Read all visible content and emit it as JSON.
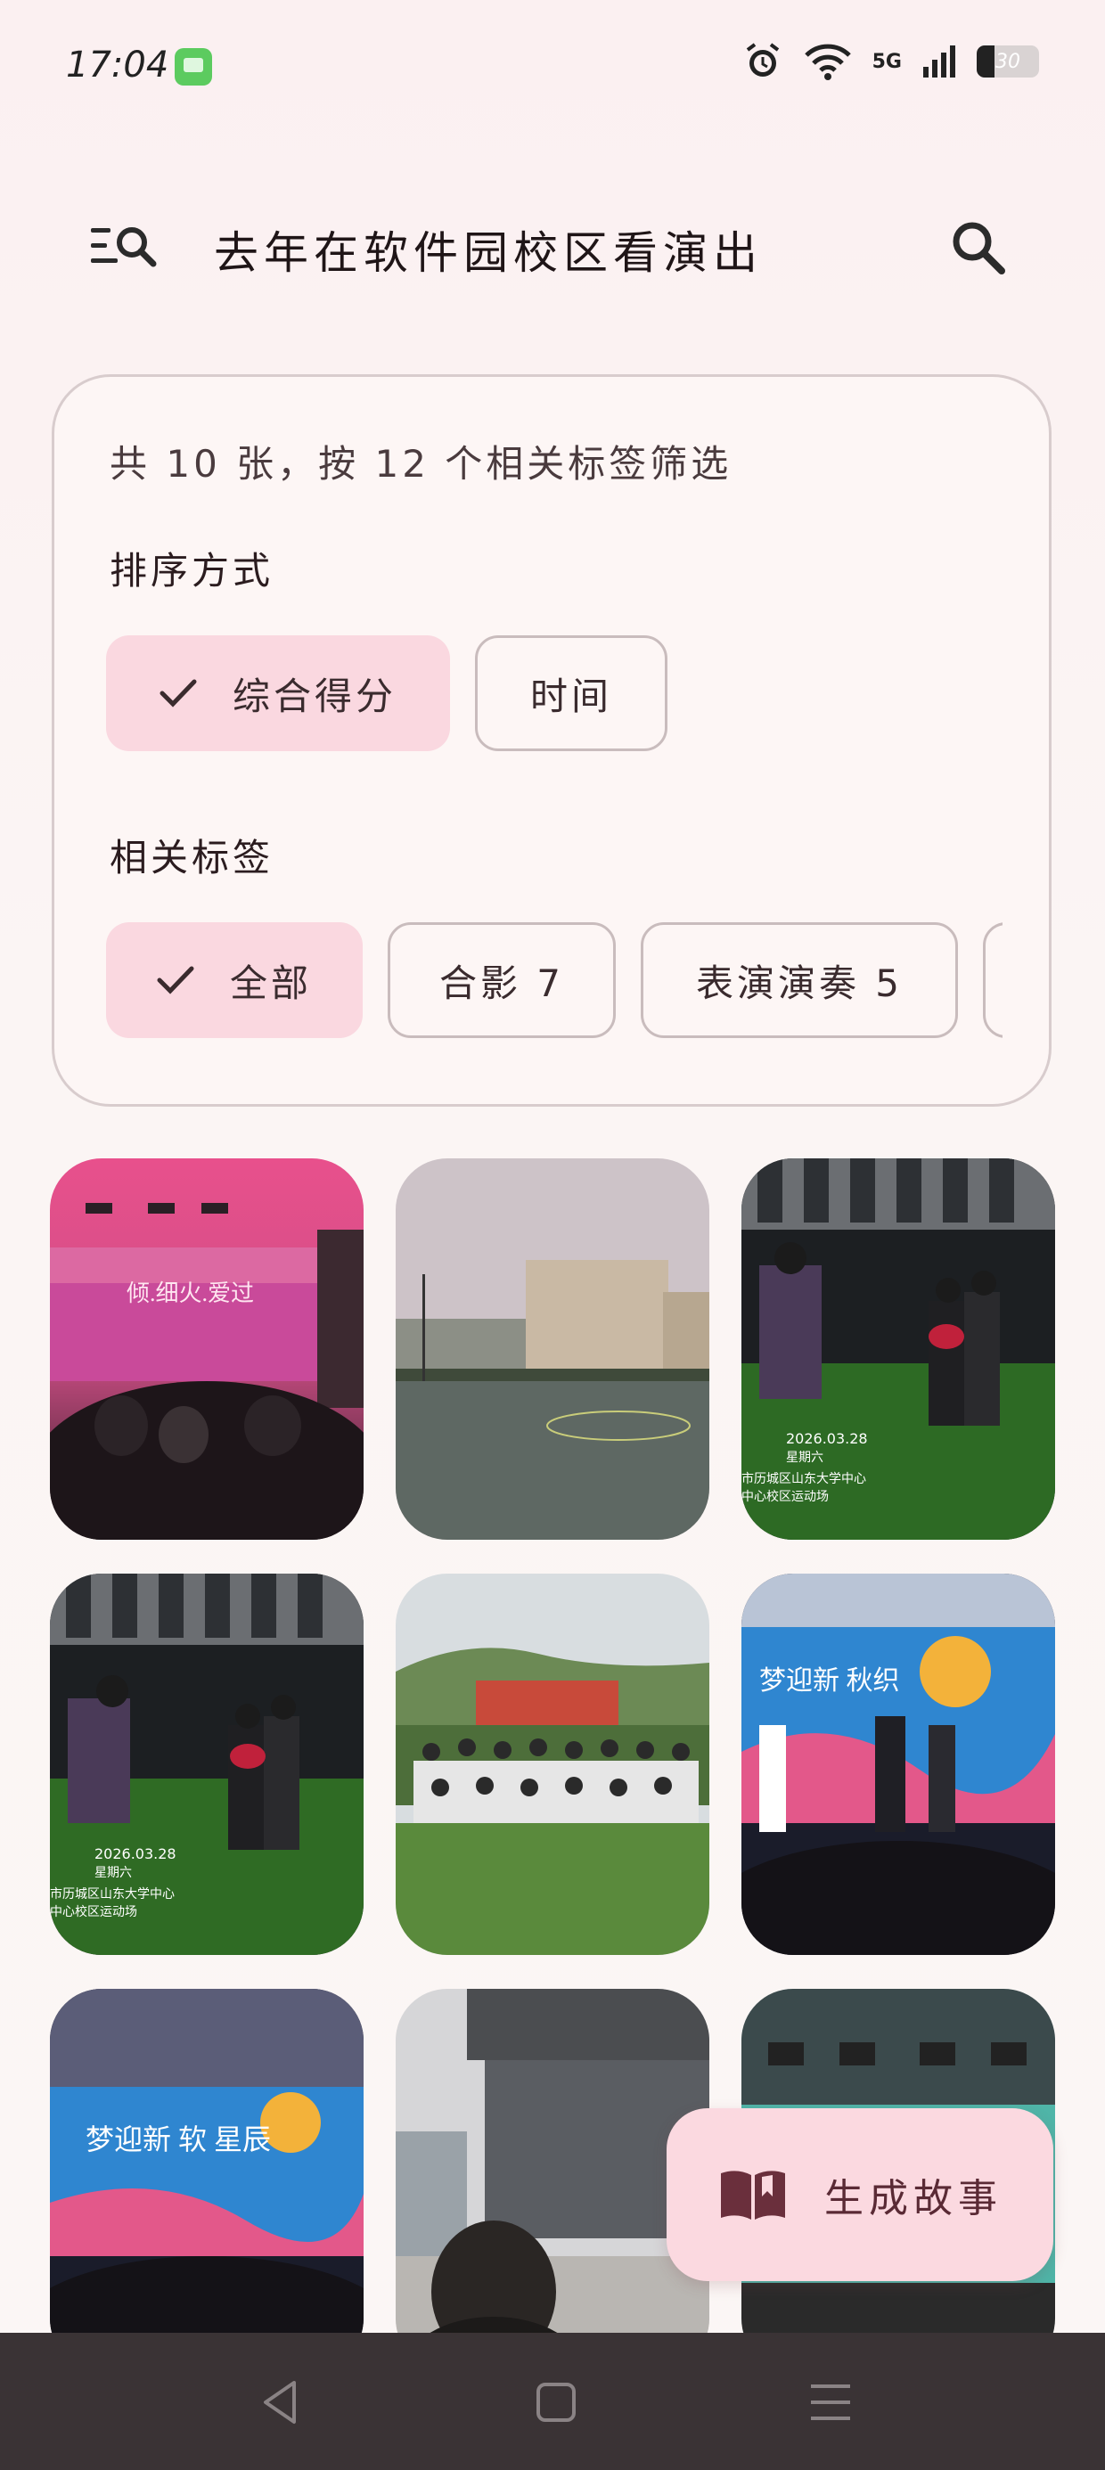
{
  "status_bar": {
    "time": "17:04",
    "network": "5G",
    "battery": "30"
  },
  "top_bar": {
    "title": "去年在软件园校区看演出",
    "menu_icon": "filter-list-search-icon",
    "search_icon": "search-icon"
  },
  "filter_card": {
    "summary": "共 10 张，按 12 个相关标签筛选",
    "sort_label": "排序方式",
    "sort_options": [
      {
        "label": "综合得分",
        "selected": true
      },
      {
        "label": "时间",
        "selected": false
      }
    ],
    "tags_label": "相关标签",
    "tag_options": [
      {
        "label": "全部",
        "selected": true
      },
      {
        "label": "合影 7",
        "selected": false
      },
      {
        "label": "表演演奏 5",
        "selected": false
      }
    ]
  },
  "photos": [
    {
      "name": "photo-stage-pink",
      "overlay": "倾.细火.爱过"
    },
    {
      "name": "photo-campus-court"
    },
    {
      "name": "photo-night-stage-1",
      "date": "2026.03.28",
      "weekday": "星期六",
      "location": "市历城区山东大学中心",
      "location2": "中心校区运动场"
    },
    {
      "name": "photo-night-stage-2",
      "date": "2026.03.28",
      "weekday": "星期六",
      "location": "市历城区山东大学中心",
      "location2": "中心校区运动场"
    },
    {
      "name": "photo-group-lawn"
    },
    {
      "name": "photo-stage-banner",
      "overlay": "梦迎新 秋织"
    },
    {
      "name": "photo-stage-banner-2",
      "overlay": "梦迎新 软 星辰"
    },
    {
      "name": "photo-building-plaza"
    },
    {
      "name": "photo-hall-stage"
    }
  ],
  "fab": {
    "label": "生成故事",
    "icon": "open-book-icon"
  },
  "colors": {
    "accent_chip": "#fad8e0",
    "fab": "#fbd9e0",
    "navbar": "#3a3335"
  }
}
